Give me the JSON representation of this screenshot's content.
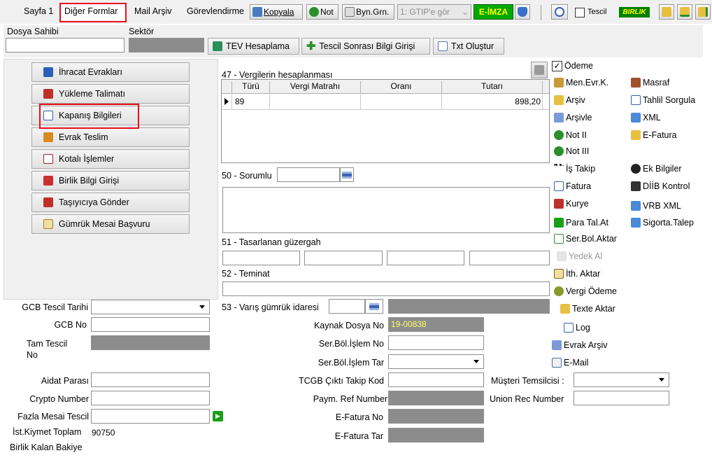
{
  "tabs": [
    "Sayfa 1",
    "Diğer Formlar",
    "Mail Arşiv",
    "Görevlendirme"
  ],
  "toolbar": {
    "kopyala": "Kopyala",
    "not": "Not",
    "byn_grn": "Byn.Grn.",
    "gtip_select": "1: GTIP'e gör",
    "eimza": "E-İMZA",
    "tescil": "Tescil",
    "birlik": "BIRLIK"
  },
  "header": {
    "dosya_sahibi": "Dosya Sahibi",
    "sektor": "Sektör",
    "tev": "TEV Hesaplama",
    "tescil_sonrasi": "Tescil Sonrası Bilgi Girişi",
    "txt": "Txt Oluştur"
  },
  "left_buttons": [
    "İhracat Evrakları",
    "Yükleme Talimatı",
    "Kapanış Bilgileri",
    "Evrak Teslim",
    "Kotalı İşlemler",
    "Birlik Bilgi Girişi",
    "Taşıyıcıya Gönder",
    "Gümrük Mesai Başvuru"
  ],
  "taxes": {
    "title": "47 - Vergilerin hesaplanması",
    "columns": [
      "Türü",
      "Vergi Matrahı",
      "Oranı",
      "Tutarı"
    ],
    "row": {
      "turu": "89",
      "matrah": "",
      "orani": "",
      "tutari": "898,20"
    }
  },
  "sorumlu": "50 - Sorumlu",
  "guzergah": "51 - Tasarlanan güzergah",
  "teminat": "52 - Teminat",
  "varis": "53 - Varış gümrük idaresi",
  "left_form": {
    "gcb_tescil_tarihi": "GCB Tescil Tarihi",
    "gcb_no": "GCB No",
    "tam_tescil_1": "Tam Tescil",
    "tam_tescil_2": "No",
    "aidat": "Aidat Parası",
    "crypto": "Crypto Number",
    "fazla_mesai": "Fazla Mesai Tescil",
    "ist_kiymet_label": "İst.Kiymet Toplam",
    "ist_kiymet_value": "90750",
    "birlik_kalan": "Birlik Kalan Bakiye"
  },
  "mid_form": {
    "kaynak_label": "Kaynak Dosya No",
    "kaynak_value": "19-00838",
    "ser_bol_islem_no": "Ser.Böl.İşlem No",
    "ser_bol_islem_tar": "Ser.Böl.İşlem Tar",
    "tcgb": "TCGB Çıktı Takip Kod",
    "paym": "Paym. Ref Number",
    "efatura_no": "E-Fatura No",
    "efatura_tar": "E-Fatura Tar"
  },
  "right_form": {
    "musteri": "Müşteri Temsilcisi :",
    "union": "Union Rec Number"
  },
  "odeme": "Ödeme",
  "right_col1": [
    "Men.Evr.K.",
    "Arşiv",
    "Arşivle",
    "Not II",
    "Not III",
    "İş Takip",
    "Fatura",
    "Kurye",
    "Para Tal.At",
    "Ser.Bol.Aktar",
    "Yedek Al",
    "İth. Aktar",
    "Vergi Ödeme",
    "Texte Aktar",
    "Log",
    "Evrak Arşiv",
    "E-Mail"
  ],
  "right_col2": [
    "Masraf",
    "Tahlil Sorgula",
    "XML",
    "E-Fatura",
    "Ek Bilgiler",
    "DİİB Kontrol",
    "VRB XML",
    "Sigorta.Talep"
  ],
  "colors": {
    "highlight": "#e8101a",
    "eimza_bg": "#00a800",
    "eimza_fg": "#ffff00",
    "birlik_bg": "#008000",
    "kaynak_fg": "#ffff66"
  }
}
